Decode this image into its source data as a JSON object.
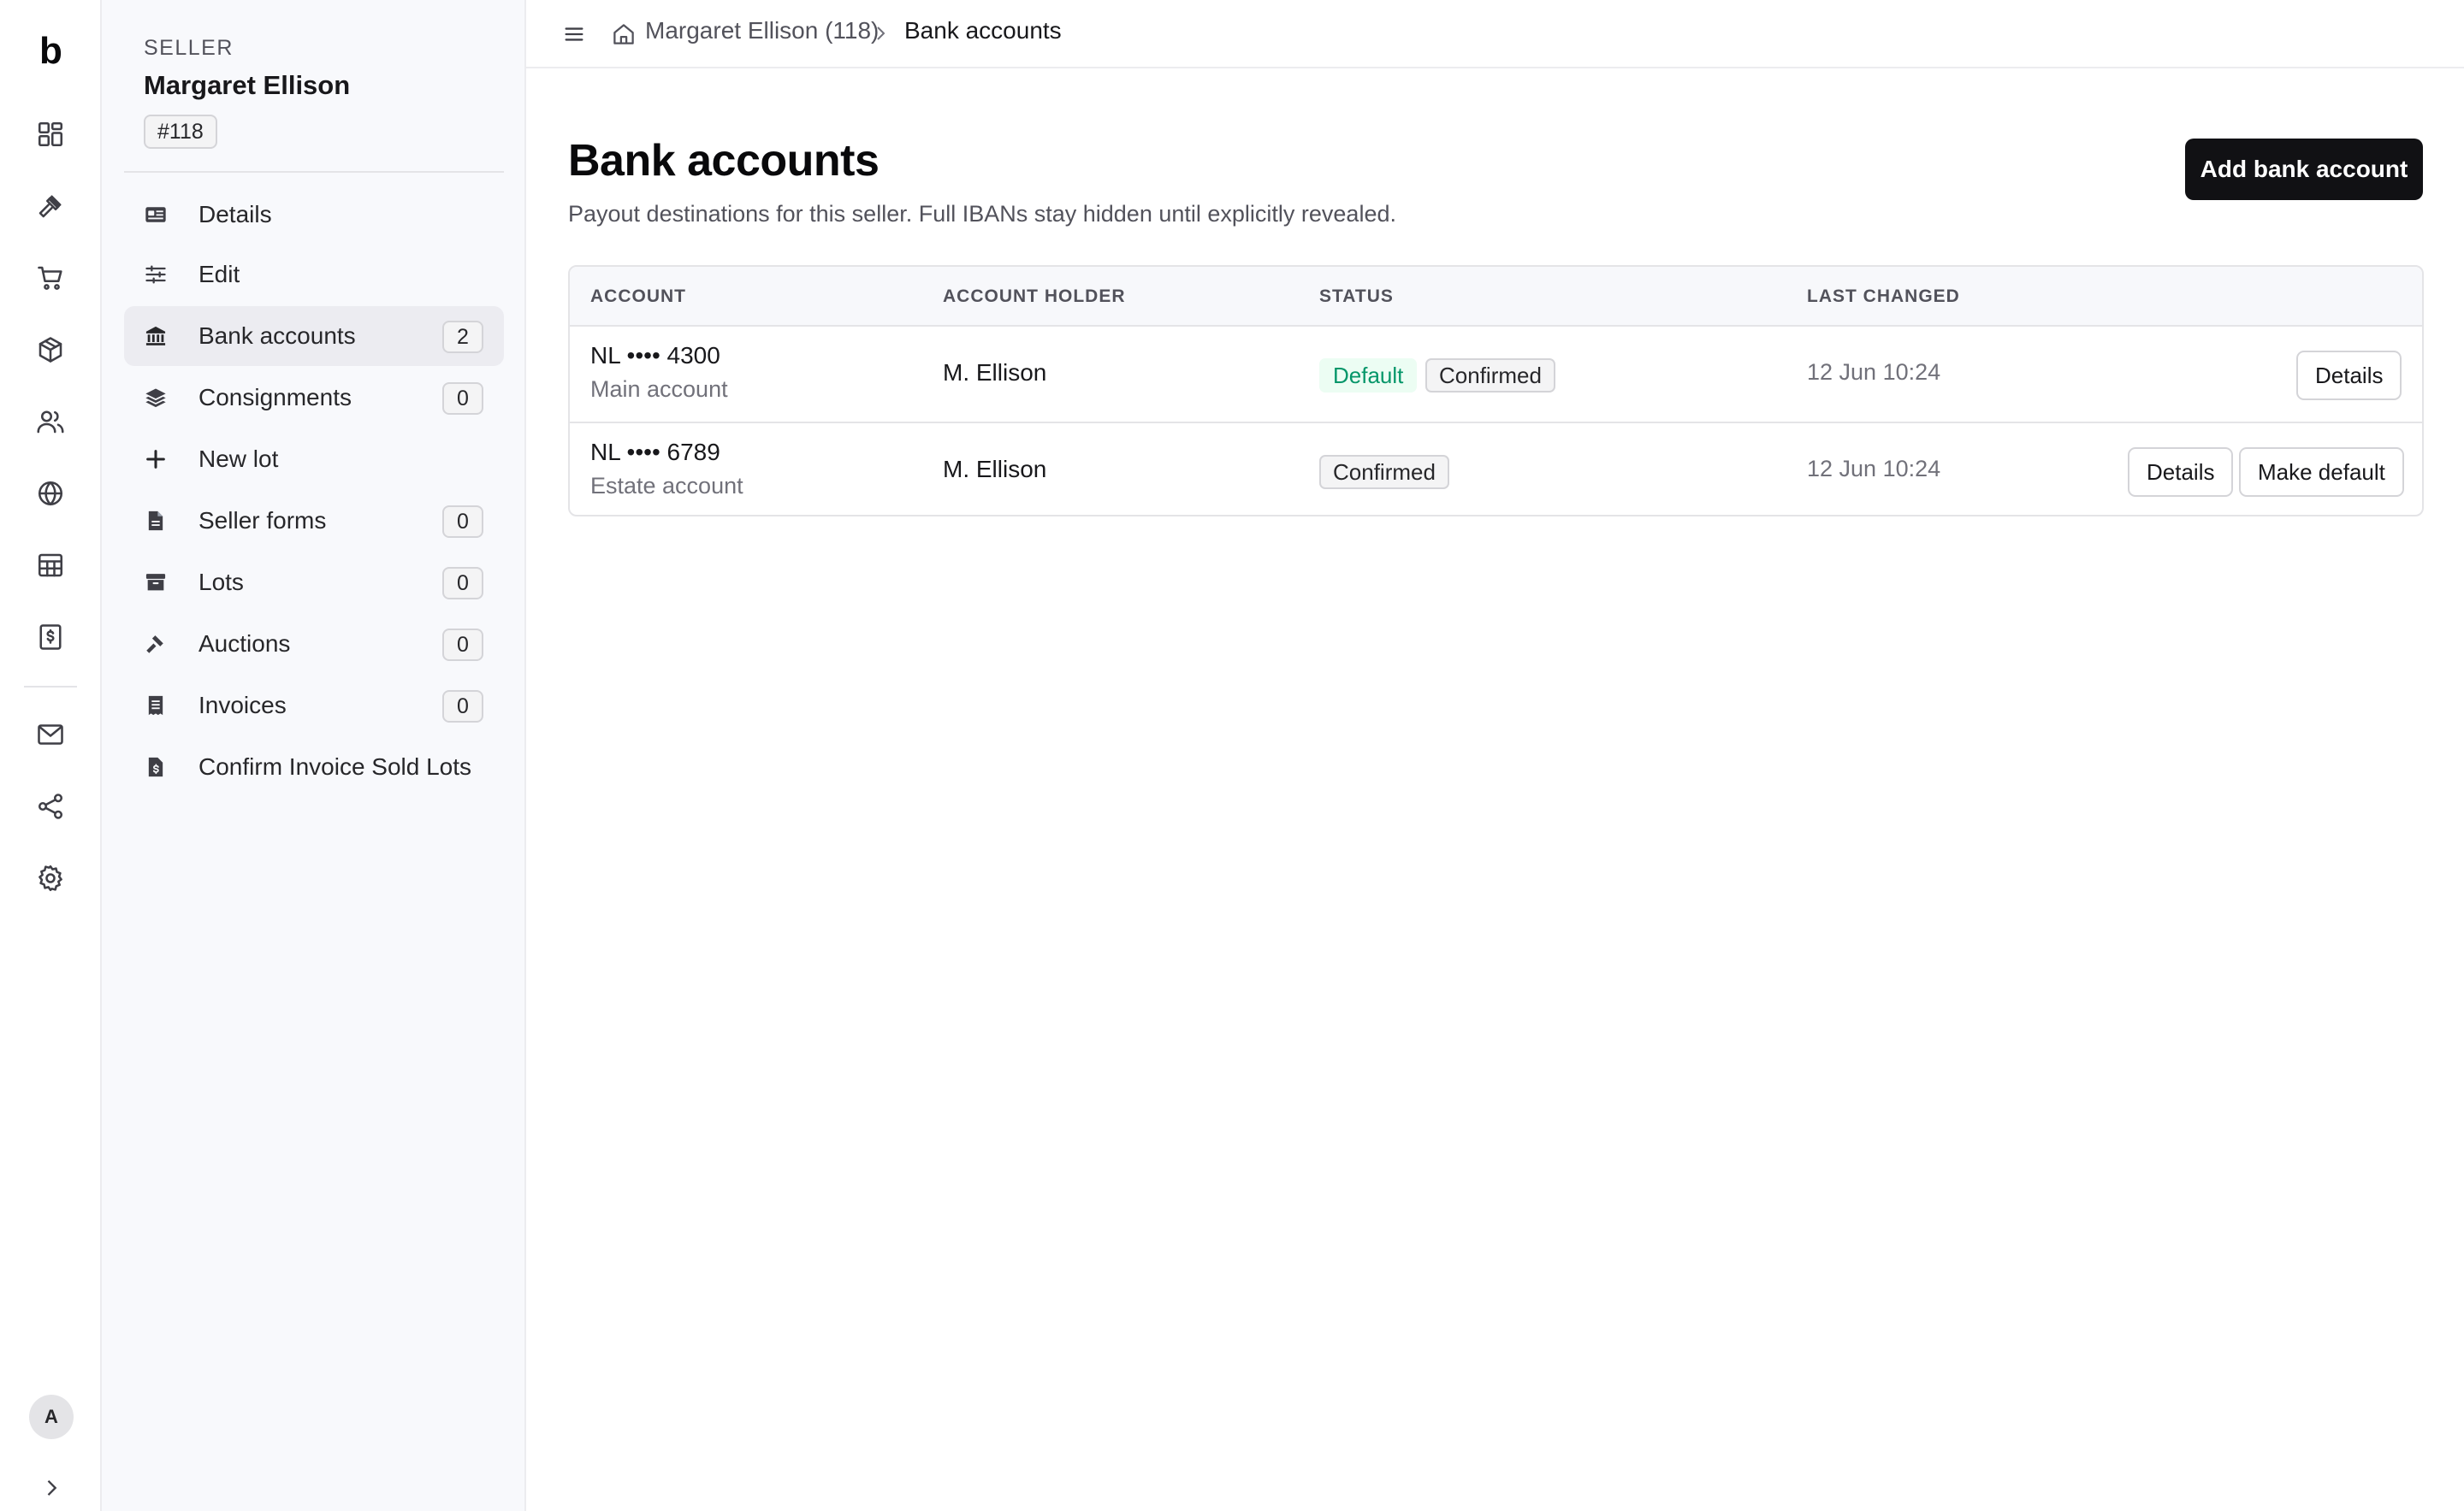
{
  "rail": {
    "logo": "b",
    "icons": [
      "dashboard-icon",
      "gavel-icon",
      "cart-icon",
      "package-icon",
      "users-icon",
      "globe-icon",
      "table-icon",
      "receipt-icon",
      "mail-icon",
      "share-icon",
      "gear-icon"
    ],
    "avatar": "A"
  },
  "seller": {
    "eyebrow": "SELLER",
    "name": "Margaret Ellison",
    "id": "#118"
  },
  "nav": [
    {
      "label": "Details",
      "icon": "id-card-icon",
      "count": null,
      "active": false
    },
    {
      "label": "Edit",
      "icon": "sliders-icon",
      "count": null,
      "active": false
    },
    {
      "label": "Bank accounts",
      "icon": "bank-icon",
      "count": "2",
      "active": true
    },
    {
      "label": "Consignments",
      "icon": "layers-icon",
      "count": "0",
      "active": false
    },
    {
      "label": "New lot",
      "icon": "plus-icon",
      "count": null,
      "active": false
    },
    {
      "label": "Seller forms",
      "icon": "file-icon",
      "count": "0",
      "active": false
    },
    {
      "label": "Lots",
      "icon": "archive-icon",
      "count": "0",
      "active": false
    },
    {
      "label": "Auctions",
      "icon": "hammer-icon",
      "count": "0",
      "active": false
    },
    {
      "label": "Invoices",
      "icon": "receipt-icon",
      "count": "0",
      "active": false
    },
    {
      "label": "Confirm Invoice Sold Lots",
      "icon": "file-dollar-icon",
      "count": null,
      "active": false
    }
  ],
  "breadcrumb": {
    "parent": "Margaret Ellison (118)",
    "current": "Bank accounts"
  },
  "page": {
    "title": "Bank accounts",
    "subtitle": "Payout destinations for this seller. Full IBANs stay hidden until explicitly revealed.",
    "add_button": "Add bank account"
  },
  "table": {
    "headers": [
      "ACCOUNT",
      "ACCOUNT HOLDER",
      "STATUS",
      "LAST CHANGED"
    ],
    "rows": [
      {
        "account": "NL •••• 4300",
        "account_label": "Main account",
        "holder": "M. Ellison",
        "badges": [
          "Default",
          "Confirmed"
        ],
        "last_changed": "12 Jun 10:24",
        "actions": [
          "Details"
        ]
      },
      {
        "account": "NL •••• 6789",
        "account_label": "Estate account",
        "holder": "M. Ellison",
        "badges": [
          "Confirmed"
        ],
        "last_changed": "12 Jun 10:24",
        "actions": [
          "Details",
          "Make default"
        ]
      }
    ]
  },
  "colors": {
    "primary_button": "#111114",
    "default_badge_text": "#059669",
    "default_badge_bg": "#ecfdf3",
    "sidebar_bg": "#f8f9fc"
  }
}
